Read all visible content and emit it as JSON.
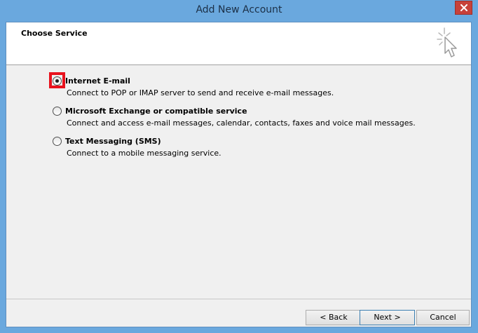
{
  "window": {
    "title": "Add New Account"
  },
  "header": {
    "title": "Choose Service",
    "icon": "wizard-cursor-icon"
  },
  "options": [
    {
      "id": "internet-email",
      "label": "Internet E-mail",
      "description": "Connect to POP or IMAP server to send and receive e-mail messages.",
      "selected": true
    },
    {
      "id": "exchange",
      "label": "Microsoft Exchange or compatible service",
      "description": "Connect and access e-mail messages, calendar, contacts, faxes and voice mail messages.",
      "selected": false
    },
    {
      "id": "sms",
      "label": "Text Messaging (SMS)",
      "description": "Connect to a mobile messaging service.",
      "selected": false
    }
  ],
  "buttons": {
    "back": "< Back",
    "next": "Next >",
    "cancel": "Cancel"
  },
  "colors": {
    "titlebar": "#6aa8de",
    "close": "#c7413a",
    "highlight": "#e8121d",
    "dialog_bg": "#f0f0f0"
  }
}
